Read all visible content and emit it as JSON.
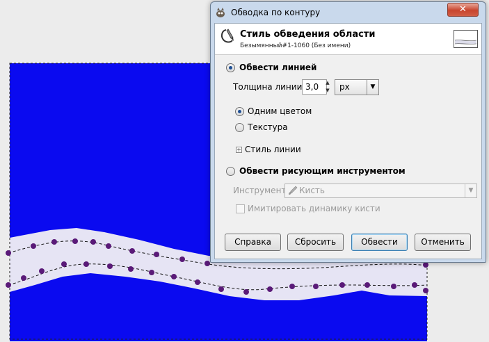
{
  "dialog": {
    "title": "Обводка по контуру",
    "close_label": "✕",
    "header": {
      "title": "Стиль обведения области",
      "subtitle": "Безымянный#1-1060 (Без имени)"
    },
    "stroke_line": {
      "label": "Обвести линией",
      "selected": true,
      "width_label": "Толщина линии:",
      "width_value": "3,0",
      "unit_value": "px",
      "solid_label": "Одним цветом",
      "pattern_label": "Текстура",
      "line_style_label": "Стиль линии"
    },
    "stroke_tool": {
      "label": "Обвести рисующим инструментом",
      "selected": false,
      "tool_label": "Инструмент:",
      "tool_value": "Кисть",
      "emulate_label": "Имитировать динамику кисти"
    },
    "buttons": {
      "help": "Справка",
      "reset": "Сбросить",
      "stroke": "Обвести",
      "cancel": "Отменить"
    }
  },
  "colors": {
    "image_blue": "#0a0af0",
    "stroke_band": "#e6e4f4",
    "dots": "#5a1a78"
  }
}
